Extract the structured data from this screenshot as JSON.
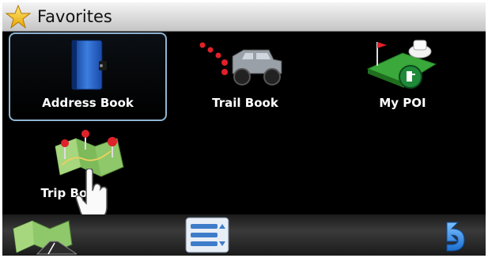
{
  "window": {
    "title": "Favorites",
    "title_icon": "star-icon"
  },
  "tiles": [
    {
      "label": "Address Book",
      "icon": "address-book-icon",
      "selected": true
    },
    {
      "label": "Trail Book",
      "icon": "jeep-icon",
      "selected": false
    },
    {
      "label": "My POI",
      "icon": "poi-icon",
      "selected": false
    },
    {
      "label": "Trip Book",
      "icon": "trip-map-icon",
      "selected": false
    }
  ],
  "bottom_bar": {
    "buttons": [
      {
        "icon": "map-view-icon"
      },
      {
        "icon": "list-menu-icon"
      },
      {
        "icon": "back-arrow-icon"
      }
    ]
  },
  "colors": {
    "selection_border": "#8fb4d2",
    "background": "#000000",
    "accent_blue": "#2a7bd4"
  }
}
